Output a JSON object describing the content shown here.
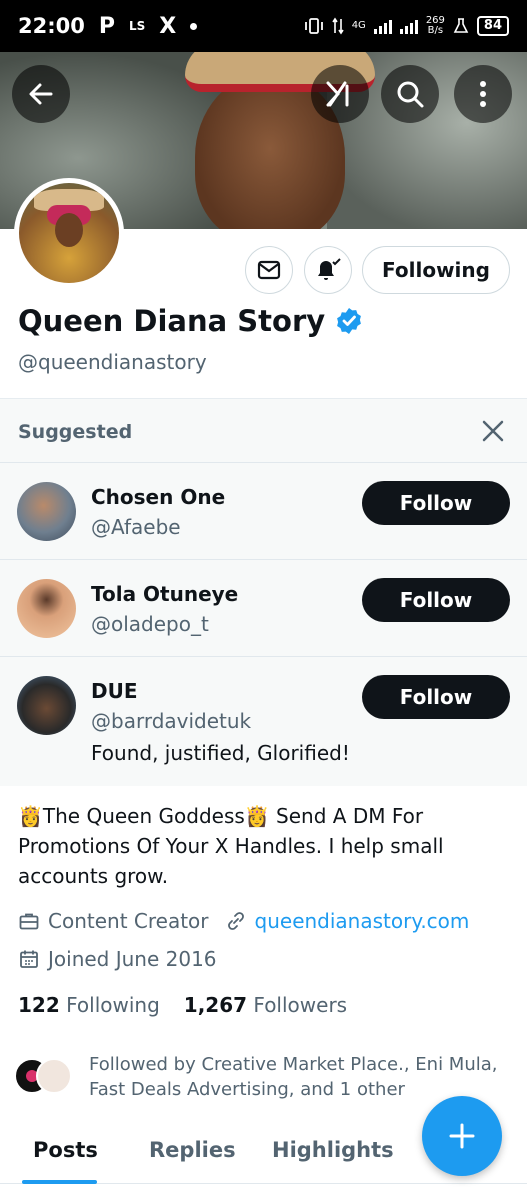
{
  "status_bar": {
    "time": "22:00",
    "left_icons": [
      "P",
      "LS",
      "X"
    ],
    "network_type": "4G",
    "net_speed": "269",
    "net_speed_unit": "B/s",
    "battery": "84"
  },
  "header": {
    "back_icon": "back-arrow-icon",
    "grok_icon": "grok-icon",
    "search_icon": "search-icon",
    "more_icon": "more-vertical-icon"
  },
  "profile": {
    "display_name": "Queen Diana Story",
    "handle": "@queendianastory",
    "verified": true,
    "following_button_label": "Following",
    "bio": "👸The Queen Goddess👸  Send A DM For Promotions Of Your X Handles.  I help small accounts grow.",
    "category": "Content Creator",
    "website": "queendianastory.com",
    "joined": "Joined June 2016",
    "following_count": "122",
    "following_label": "Following",
    "followers_count": "1,267",
    "followers_label": "Followers",
    "followed_by": "Followed by Creative Market Place., Eni Mula, Fast Deals Advertising, and 1 other"
  },
  "suggested": {
    "title": "Suggested",
    "accounts": [
      {
        "name": "Chosen One",
        "handle": "@Afaebe",
        "button": "Follow"
      },
      {
        "name": "Tola Otuneye",
        "handle": "@oladepo_t",
        "button": "Follow"
      },
      {
        "name": "DUE",
        "handle": "@barrdavidetuk",
        "bio": "Found, justified, Glorified!",
        "button": "Follow"
      }
    ]
  },
  "tabs": [
    "Posts",
    "Replies",
    "Highlights"
  ],
  "colors": {
    "accent": "#1d9bf0",
    "text_primary": "#0f1419",
    "text_secondary": "#536471"
  }
}
